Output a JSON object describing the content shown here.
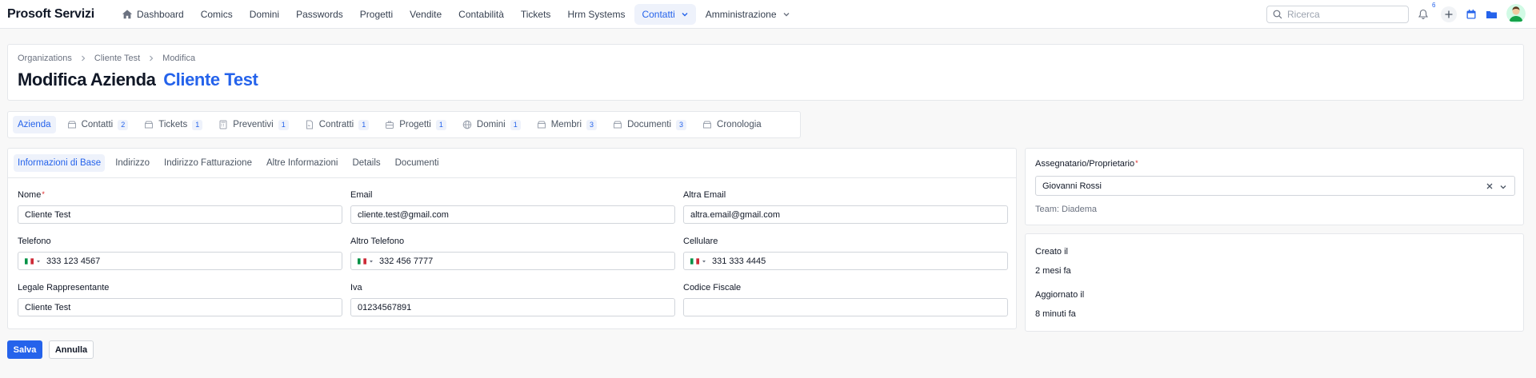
{
  "app": {
    "brand": "Prosoft Servizi"
  },
  "nav": {
    "items": [
      {
        "label": "Dashboard",
        "icon": "home-icon"
      },
      {
        "label": "Comics"
      },
      {
        "label": "Domini"
      },
      {
        "label": "Passwords"
      },
      {
        "label": "Progetti"
      },
      {
        "label": "Vendite"
      },
      {
        "label": "Contabilità"
      },
      {
        "label": "Tickets"
      },
      {
        "label": "Hrm Systems"
      },
      {
        "label": "Contatti",
        "active": true,
        "dropdown": true
      },
      {
        "label": "Amministrazione",
        "dropdown": true
      }
    ],
    "search_placeholder": "Ricerca",
    "notification_count": "6"
  },
  "breadcrumb": [
    "Organizations",
    "Cliente Test",
    "Modifica"
  ],
  "page_title": {
    "prefix": "Modifica Azienda",
    "name": "Cliente Test"
  },
  "main_tabs": [
    {
      "label": "Azienda",
      "active": true
    },
    {
      "label": "Contatti",
      "count": "2",
      "icon": "address-book-icon"
    },
    {
      "label": "Tickets",
      "count": "1",
      "icon": "ticket-icon"
    },
    {
      "label": "Preventivi",
      "count": "1",
      "icon": "calculator-icon"
    },
    {
      "label": "Contratti",
      "count": "1",
      "icon": "contract-icon"
    },
    {
      "label": "Progetti",
      "count": "1",
      "icon": "briefcase-icon"
    },
    {
      "label": "Domini",
      "count": "1",
      "icon": "globe-icon"
    },
    {
      "label": "Membri",
      "count": "3",
      "icon": "users-icon"
    },
    {
      "label": "Documenti",
      "count": "3",
      "icon": "folder-icon"
    },
    {
      "label": "Cronologia",
      "icon": "history-icon"
    }
  ],
  "sub_tabs": [
    {
      "label": "Informazioni di Base",
      "active": true
    },
    {
      "label": "Indirizzo"
    },
    {
      "label": "Indirizzo Fatturazione"
    },
    {
      "label": "Altre Informazioni"
    },
    {
      "label": "Details"
    },
    {
      "label": "Documenti"
    }
  ],
  "form": {
    "nome": {
      "label": "Nome",
      "value": "Cliente Test",
      "required": true
    },
    "email": {
      "label": "Email",
      "value": "cliente.test@gmail.com"
    },
    "altra_email": {
      "label": "Altra Email",
      "value": "altra.email@gmail.com"
    },
    "telefono": {
      "label": "Telefono",
      "value": "333 123 4567"
    },
    "altro_telefono": {
      "label": "Altro Telefono",
      "value": "332 456 7777"
    },
    "cellulare": {
      "label": "Cellulare",
      "value": "331 333 4445"
    },
    "legale": {
      "label": "Legale Rappresentante",
      "value": "Cliente Test"
    },
    "iva": {
      "label": "Iva",
      "value": "01234567891"
    },
    "codice_fiscale": {
      "label": "Codice Fiscale",
      "value": ""
    }
  },
  "buttons": {
    "save": "Salva",
    "cancel": "Annulla"
  },
  "owner": {
    "label": "Assegnatario/Proprietario",
    "value": "Giovanni Rossi",
    "team": "Team: Diadema"
  },
  "meta": {
    "created_label": "Creato il",
    "created_value": "2 mesi fa",
    "updated_label": "Aggiornato il",
    "updated_value": "8 minuti fa"
  },
  "colors": {
    "accent": "#2563eb",
    "required": "#dc2626",
    "border": "#d1d5db"
  }
}
